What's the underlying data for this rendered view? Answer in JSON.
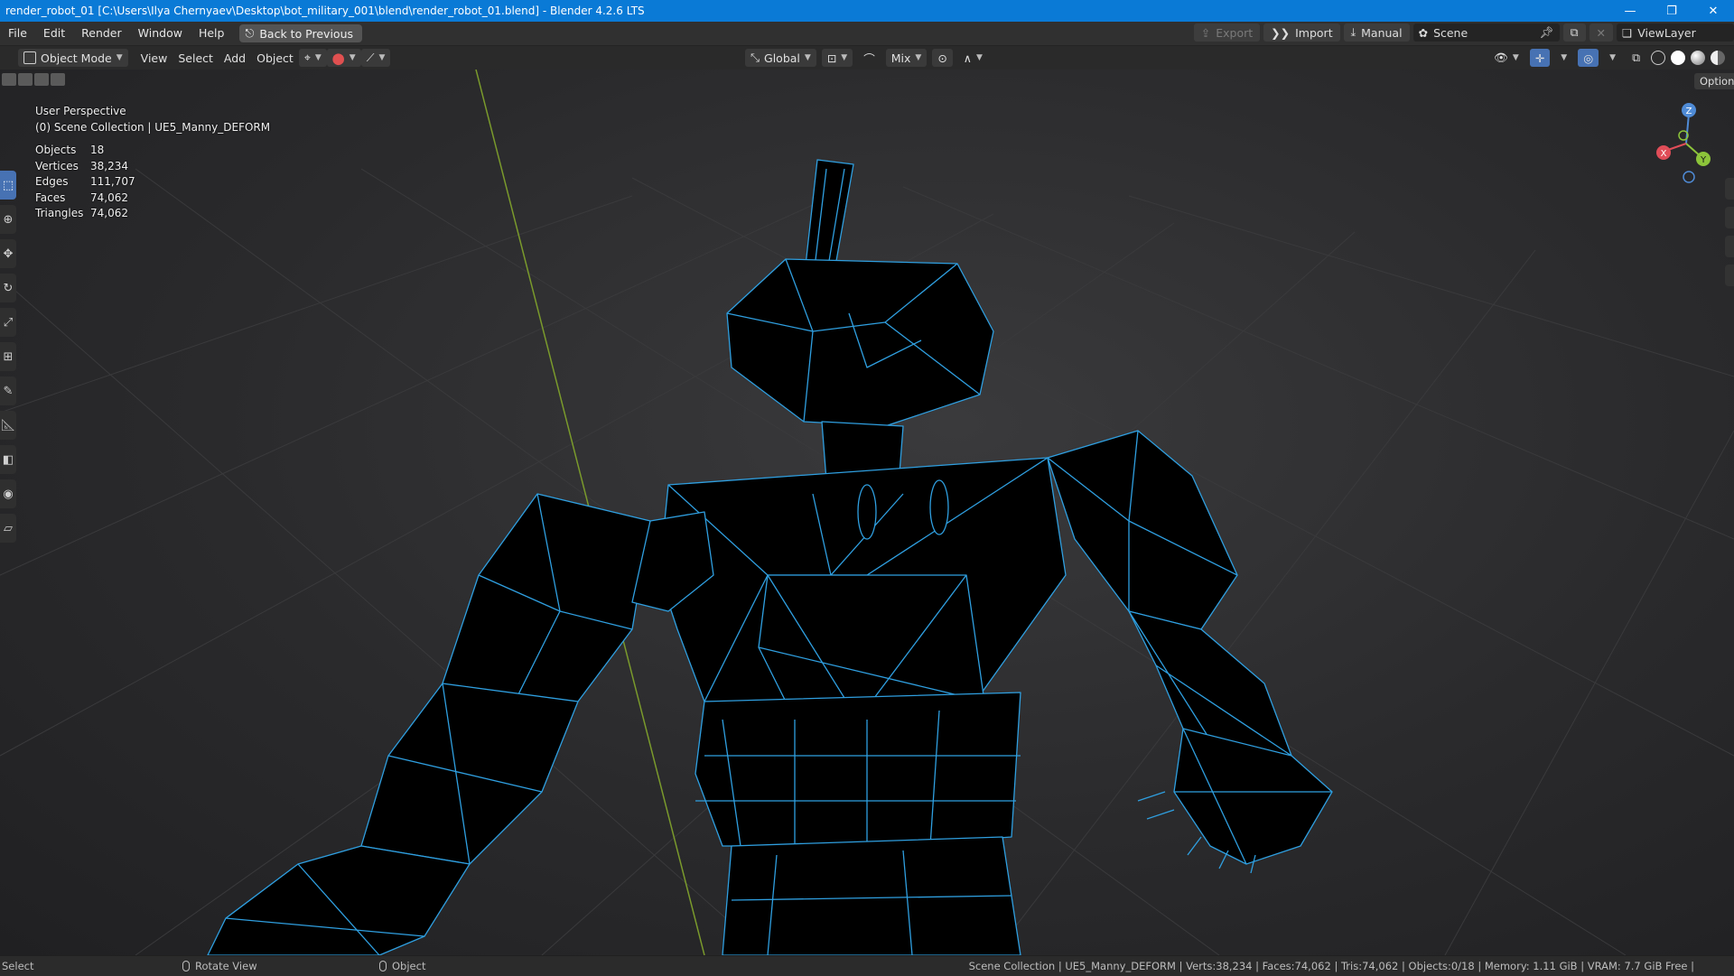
{
  "window": {
    "title": "render_robot_01 [C:\\Users\\Ilya Chernyaev\\Desktop\\bot_military_001\\blend\\render_robot_01.blend] - Blender 4.2.6 LTS",
    "minimize": "—",
    "restore": "❐",
    "close": "✕"
  },
  "menubar": {
    "items": [
      "File",
      "Edit",
      "Render",
      "Window",
      "Help"
    ],
    "back_to_previous": "Back to Previous",
    "export": "Export",
    "import": "Import",
    "manual": "Manual",
    "scene": "Scene",
    "view_layer": "ViewLayer"
  },
  "header": {
    "mode": "Object Mode",
    "menus": [
      "View",
      "Select",
      "Add",
      "Object"
    ],
    "transform_orientation": "Global",
    "snap_mode": "Mix"
  },
  "viewport": {
    "view_name": "User Perspective",
    "collection_info": "(0) Scene Collection | UE5_Manny_DEFORM",
    "options_label": "Options",
    "stats": [
      {
        "label": "Objects",
        "value": "18"
      },
      {
        "label": "Vertices",
        "value": "38,234"
      },
      {
        "label": "Edges",
        "value": "111,707"
      },
      {
        "label": "Faces",
        "value": "74,062"
      },
      {
        "label": "Triangles",
        "value": "74,062"
      }
    ],
    "gizmo": {
      "x": "X",
      "y": "Y",
      "z": "Z"
    },
    "colors": {
      "wire": "#2f9fe0",
      "fill": "#000000",
      "grid": "#3c3c3e",
      "y_axis": "#7a9a2c"
    }
  },
  "statusbar": {
    "left_action": "Select",
    "middle_action": "Rotate View",
    "right_action": "Object",
    "info": "Scene Collection | UE5_Manny_DEFORM | Verts:38,234 | Faces:74,062 | Tris:74,062 | Objects:0/18 | Memory: 1.11 GiB | VRAM: 7.7 GiB Free |"
  }
}
